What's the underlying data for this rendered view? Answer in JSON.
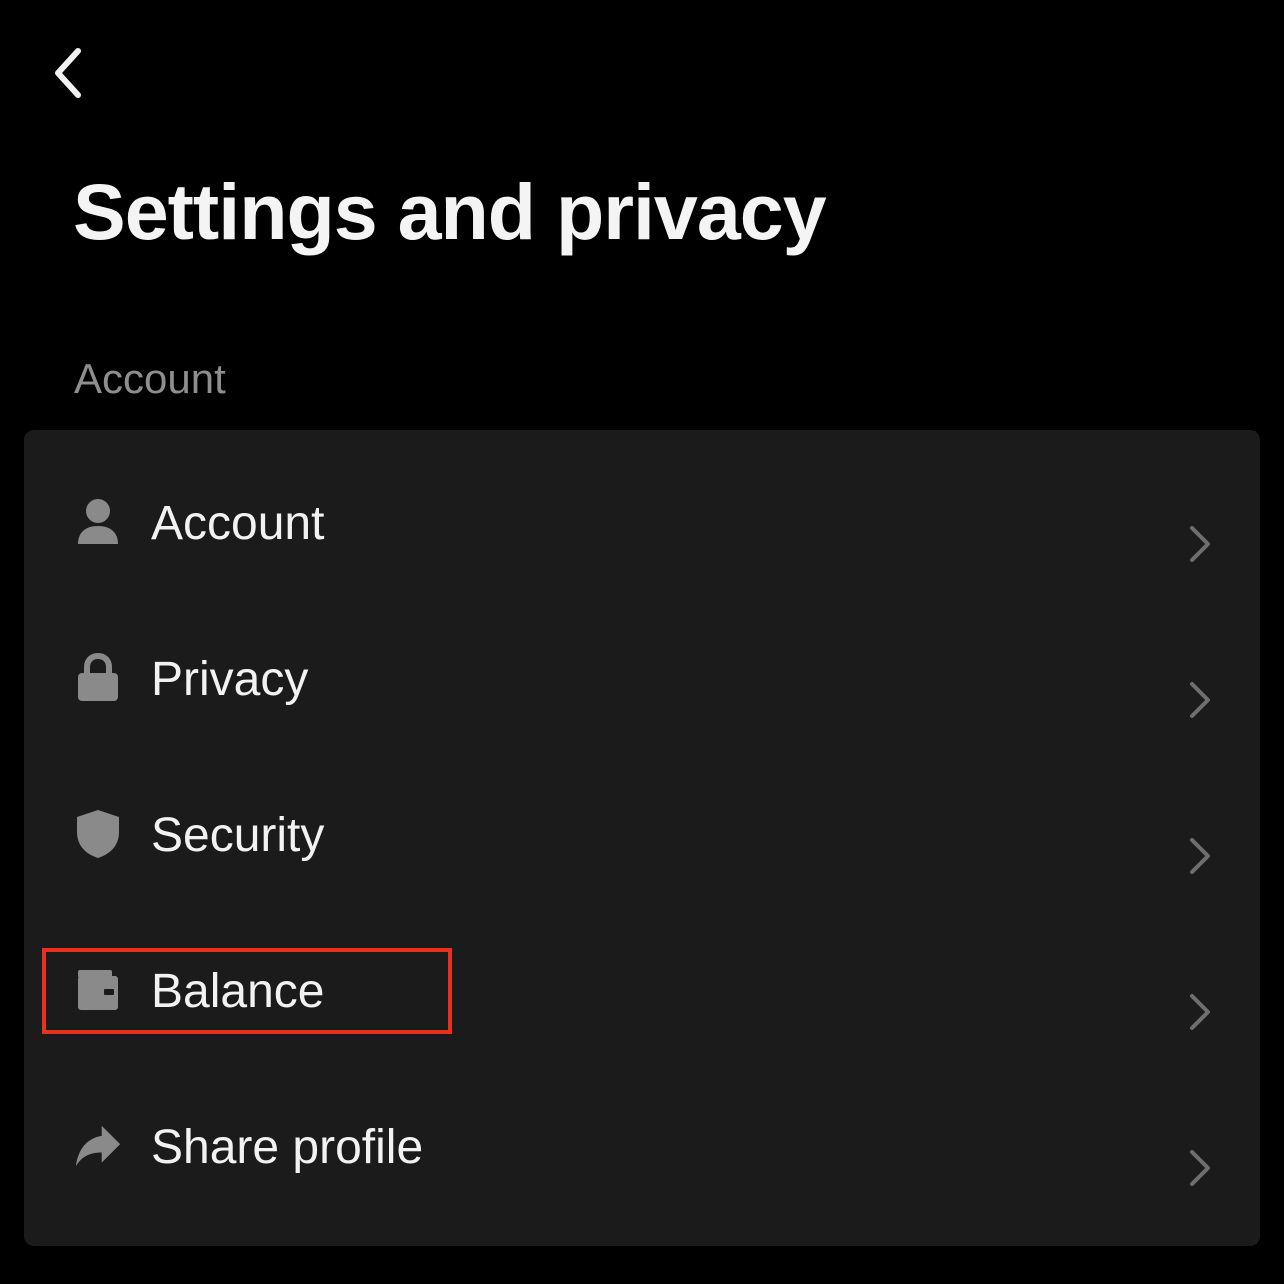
{
  "header": {
    "back_icon": "chevron-left-icon",
    "title": "Settings and privacy"
  },
  "section": {
    "title": "Account"
  },
  "items": [
    {
      "label": "Account",
      "icon": "person-icon"
    },
    {
      "label": "Privacy",
      "icon": "lock-icon"
    },
    {
      "label": "Security",
      "icon": "shield-icon"
    },
    {
      "label": "Balance",
      "icon": "wallet-icon",
      "highlighted": true
    },
    {
      "label": "Share profile",
      "icon": "share-arrow-icon"
    }
  ],
  "colors": {
    "background": "#000000",
    "card": "#1b1b1b",
    "text": "#f2f2f2",
    "muted": "#8e8e8e",
    "icon": "#8a8a8a",
    "highlight": "#e8321f"
  }
}
